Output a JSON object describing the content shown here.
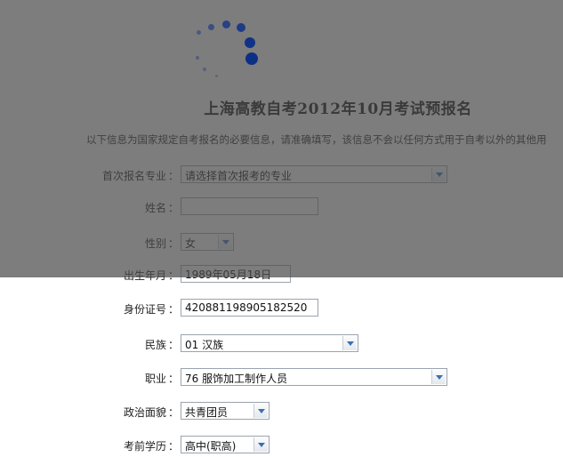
{
  "page": {
    "title": "上海高教自考2012年10月考试预报名",
    "notice": "以下信息为国家规定自考报名的必要信息，请准确填写，该信息不会以任何方式用于自考以外的其他用"
  },
  "form": {
    "major": {
      "label": "首次报名专业",
      "value": "请选择首次报考的专业"
    },
    "name": {
      "label": "姓名",
      "value": ""
    },
    "gender": {
      "label": "性别",
      "value": "女"
    },
    "birth": {
      "label": "出生年月",
      "value": "1989年05月18日"
    },
    "id_number": {
      "label": "身份证号",
      "value": "420881198905182520"
    },
    "ethnicity": {
      "label": "民族",
      "value": "01 汉族"
    },
    "occupation": {
      "label": "职业",
      "value": "76 服饰加工制作人员"
    },
    "political_status": {
      "label": "政治面貌",
      "value": "共青团员"
    },
    "education": {
      "label": "考前学历",
      "value": "高中(职高)"
    },
    "colon": "："
  },
  "colors": {
    "overlay": "#4b4b4b",
    "spinner": "#0c2f86",
    "dropdown_arrow": "#3a6fb3"
  },
  "icons": {
    "loading": "loading-spinner-icon",
    "dropdown": "chevron-down-icon"
  }
}
